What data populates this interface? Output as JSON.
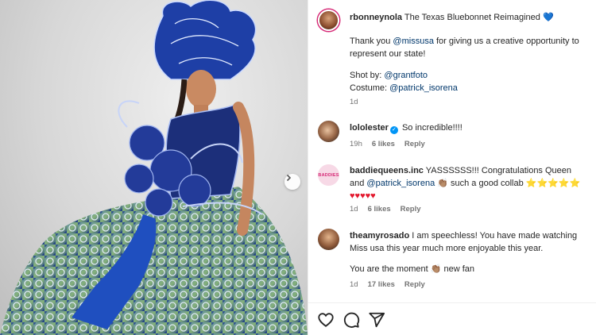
{
  "post": {
    "username": "rbonneynola",
    "caption_title": "The Texas Bluebonnet Reimagined",
    "caption_heart": "💙",
    "caption_line1_pre": "Thank you ",
    "caption_line1_mention": "@missusa",
    "caption_line1_post": " for giving us a creative opportunity to represent our state!",
    "shot_by_label": "Shot by: ",
    "shot_by_mention": "@grantfoto",
    "costume_label": "Costume: ",
    "costume_mention": "@patrick_isorena",
    "time": "1d"
  },
  "comments": [
    {
      "username": "lololester",
      "verified": true,
      "text": "So incredible!!!!",
      "time": "19h",
      "likes": "6 likes",
      "reply": "Reply"
    },
    {
      "username": "baddiequeens.inc",
      "avatar_text": "BADDIES",
      "text_pre": "YASSSSSS!!! Congratulations Queen and ",
      "mention": "@patrick_isorena",
      "text_post": " 👏🏽 such a good collab ⭐⭐⭐⭐⭐",
      "hearts": "♥♥♥♥♥",
      "time": "1d",
      "likes": "6 likes",
      "reply": "Reply"
    },
    {
      "username": "theamyrosado",
      "text": "I am speechless! You have made watching Miss usa this year much more enjoyable this year.",
      "text2": "You are the moment 👏🏽 new fan",
      "time": "1d",
      "likes": "17 likes",
      "reply": "Reply"
    }
  ],
  "actions": {
    "like_icon": "heart-icon",
    "comment_icon": "comment-icon",
    "share_icon": "share-icon"
  },
  "colors": {
    "link": "#00376b",
    "meta": "#737373",
    "verified": "#0095f6",
    "story_ring": "#d62976"
  }
}
